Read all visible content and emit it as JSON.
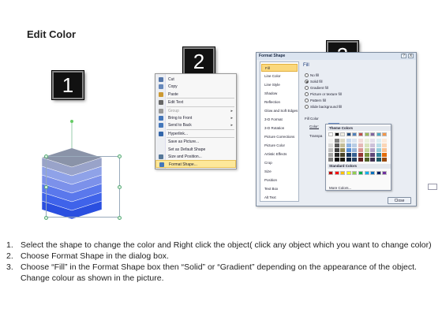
{
  "title": "Edit Color",
  "steps": {
    "one": "1",
    "two": "2",
    "three": "3"
  },
  "context_menu": {
    "items": [
      {
        "label": "Cut",
        "icon": "scissors-icon",
        "color": "#5577aa"
      },
      {
        "label": "Copy",
        "icon": "copy-icon",
        "color": "#6688bb"
      },
      {
        "label": "Paste",
        "icon": "paste-icon",
        "color": "#cc9933"
      },
      {
        "label": "Edit Text",
        "icon": "edit-text-icon",
        "color": "#666666"
      },
      {
        "label": "Group",
        "icon": "group-icon",
        "color": "#999999",
        "disabled": true,
        "submenu": true
      },
      {
        "label": "Bring to Front",
        "icon": "bring-front-icon",
        "color": "#4477bb",
        "submenu": true
      },
      {
        "label": "Send to Back",
        "icon": "send-back-icon",
        "color": "#4477bb",
        "submenu": true
      },
      {
        "label": "Hyperlink...",
        "icon": "hyperlink-icon",
        "color": "#3366aa"
      },
      {
        "label": "Save as Picture...",
        "icon": "",
        "color": ""
      },
      {
        "label": "Set as Default Shape",
        "icon": "",
        "color": ""
      },
      {
        "label": "Size and Position...",
        "icon": "size-icon",
        "color": "#557799"
      },
      {
        "label": "Format Shape...",
        "icon": "format-shape-icon",
        "color": "#4477bb",
        "highlight": true
      }
    ]
  },
  "dialog": {
    "title": "Format Shape",
    "help": "?",
    "close_x": "X",
    "categories": [
      "Fill",
      "Line Color",
      "Line Style",
      "Shadow",
      "Reflection",
      "Glow and Soft Edges",
      "3-D Format",
      "3-D Rotation",
      "Picture Corrections",
      "Picture Color",
      "Artistic Effects",
      "Crop",
      "Size",
      "Position",
      "Text Box",
      "Alt Text"
    ],
    "selected_category": "Fill",
    "fill_heading": "Fill",
    "fill_options": [
      {
        "label": "No fill",
        "selected": false
      },
      {
        "label": "Solid fill",
        "selected": true
      },
      {
        "label": "Gradient fill",
        "selected": false
      },
      {
        "label": "Picture or texture fill",
        "selected": false
      },
      {
        "label": "Pattern fill",
        "selected": false
      },
      {
        "label": "Slide background fill",
        "selected": false
      }
    ],
    "fill_color_label": "Fill Color",
    "color_label": "Color:",
    "transparency_label": "Transpa",
    "palette": {
      "theme_heading": "Theme Colors",
      "standard_heading": "Standard Colors",
      "more_colors": "More Colors...",
      "theme_top": [
        "#ffffff",
        "#000000",
        "#eeece1",
        "#1f497d",
        "#4f81bd",
        "#c0504d",
        "#9bbb59",
        "#8064a2",
        "#4bacc6",
        "#f79646"
      ],
      "theme_shades": [
        [
          "#f2f2f2",
          "#7f7f7f",
          "#ddd9c3",
          "#c6d9f0",
          "#dbe5f1",
          "#f2dcdb",
          "#ebf1dd",
          "#e5e0ec",
          "#dbeef3",
          "#fdeada"
        ],
        [
          "#d8d8d8",
          "#595959",
          "#c4bd97",
          "#8db3e2",
          "#b8cce4",
          "#e5b9b7",
          "#d7e3bc",
          "#ccc1d9",
          "#b7dde8",
          "#fbd5b5"
        ],
        [
          "#bfbfbf",
          "#3f3f3f",
          "#938953",
          "#548dd4",
          "#95b3d7",
          "#d99694",
          "#c3d69b",
          "#b2a2c7",
          "#92cddc",
          "#fac08f"
        ],
        [
          "#a5a5a5",
          "#262626",
          "#494429",
          "#17365d",
          "#366092",
          "#953734",
          "#76923c",
          "#5f497a",
          "#31859b",
          "#e36c09"
        ],
        [
          "#7f7f7f",
          "#0c0c0c",
          "#1d1b10",
          "#0f243e",
          "#244061",
          "#632423",
          "#4f6128",
          "#3f3151",
          "#205867",
          "#974806"
        ]
      ],
      "standard": [
        "#c00000",
        "#ff0000",
        "#ffc000",
        "#ffff00",
        "#92d050",
        "#00b050",
        "#00b0f0",
        "#0070c0",
        "#002060",
        "#7030a0"
      ]
    },
    "close_button": "Close"
  },
  "cube": {
    "layer_colors": [
      "#99a3c9",
      "#8fa2e8",
      "#7c91ea",
      "#5a78ec",
      "#3f63ea",
      "#2a4fe0"
    ],
    "top_color": "#8a93a8"
  },
  "instructions": [
    {
      "num": "1.",
      "text": "Select the shape to change the color and Right click the object( click any object which you want to change color)"
    },
    {
      "num": "2.",
      "text": "Choose Format Shape in the dialog box."
    },
    {
      "num": "3.",
      "text": "Choose “Fill” in the Format Shape box then “Solid” or “Gradient” depending on the appearance of the object. Change colour as shown in the picture."
    }
  ]
}
